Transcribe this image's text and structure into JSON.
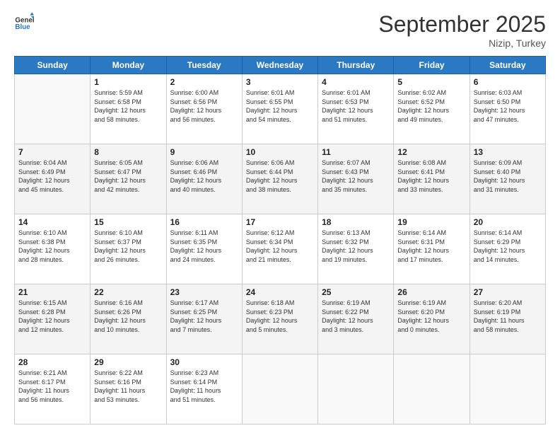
{
  "header": {
    "logo_general": "General",
    "logo_blue": "Blue",
    "month_title": "September 2025",
    "subtitle": "Nizip, Turkey"
  },
  "days_of_week": [
    "Sunday",
    "Monday",
    "Tuesday",
    "Wednesday",
    "Thursday",
    "Friday",
    "Saturday"
  ],
  "weeks": [
    [
      {
        "day": "",
        "info": ""
      },
      {
        "day": "1",
        "info": "Sunrise: 5:59 AM\nSunset: 6:58 PM\nDaylight: 12 hours\nand 58 minutes."
      },
      {
        "day": "2",
        "info": "Sunrise: 6:00 AM\nSunset: 6:56 PM\nDaylight: 12 hours\nand 56 minutes."
      },
      {
        "day": "3",
        "info": "Sunrise: 6:01 AM\nSunset: 6:55 PM\nDaylight: 12 hours\nand 54 minutes."
      },
      {
        "day": "4",
        "info": "Sunrise: 6:01 AM\nSunset: 6:53 PM\nDaylight: 12 hours\nand 51 minutes."
      },
      {
        "day": "5",
        "info": "Sunrise: 6:02 AM\nSunset: 6:52 PM\nDaylight: 12 hours\nand 49 minutes."
      },
      {
        "day": "6",
        "info": "Sunrise: 6:03 AM\nSunset: 6:50 PM\nDaylight: 12 hours\nand 47 minutes."
      }
    ],
    [
      {
        "day": "7",
        "info": "Sunrise: 6:04 AM\nSunset: 6:49 PM\nDaylight: 12 hours\nand 45 minutes."
      },
      {
        "day": "8",
        "info": "Sunrise: 6:05 AM\nSunset: 6:47 PM\nDaylight: 12 hours\nand 42 minutes."
      },
      {
        "day": "9",
        "info": "Sunrise: 6:06 AM\nSunset: 6:46 PM\nDaylight: 12 hours\nand 40 minutes."
      },
      {
        "day": "10",
        "info": "Sunrise: 6:06 AM\nSunset: 6:44 PM\nDaylight: 12 hours\nand 38 minutes."
      },
      {
        "day": "11",
        "info": "Sunrise: 6:07 AM\nSunset: 6:43 PM\nDaylight: 12 hours\nand 35 minutes."
      },
      {
        "day": "12",
        "info": "Sunrise: 6:08 AM\nSunset: 6:41 PM\nDaylight: 12 hours\nand 33 minutes."
      },
      {
        "day": "13",
        "info": "Sunrise: 6:09 AM\nSunset: 6:40 PM\nDaylight: 12 hours\nand 31 minutes."
      }
    ],
    [
      {
        "day": "14",
        "info": "Sunrise: 6:10 AM\nSunset: 6:38 PM\nDaylight: 12 hours\nand 28 minutes."
      },
      {
        "day": "15",
        "info": "Sunrise: 6:10 AM\nSunset: 6:37 PM\nDaylight: 12 hours\nand 26 minutes."
      },
      {
        "day": "16",
        "info": "Sunrise: 6:11 AM\nSunset: 6:35 PM\nDaylight: 12 hours\nand 24 minutes."
      },
      {
        "day": "17",
        "info": "Sunrise: 6:12 AM\nSunset: 6:34 PM\nDaylight: 12 hours\nand 21 minutes."
      },
      {
        "day": "18",
        "info": "Sunrise: 6:13 AM\nSunset: 6:32 PM\nDaylight: 12 hours\nand 19 minutes."
      },
      {
        "day": "19",
        "info": "Sunrise: 6:14 AM\nSunset: 6:31 PM\nDaylight: 12 hours\nand 17 minutes."
      },
      {
        "day": "20",
        "info": "Sunrise: 6:14 AM\nSunset: 6:29 PM\nDaylight: 12 hours\nand 14 minutes."
      }
    ],
    [
      {
        "day": "21",
        "info": "Sunrise: 6:15 AM\nSunset: 6:28 PM\nDaylight: 12 hours\nand 12 minutes."
      },
      {
        "day": "22",
        "info": "Sunrise: 6:16 AM\nSunset: 6:26 PM\nDaylight: 12 hours\nand 10 minutes."
      },
      {
        "day": "23",
        "info": "Sunrise: 6:17 AM\nSunset: 6:25 PM\nDaylight: 12 hours\nand 7 minutes."
      },
      {
        "day": "24",
        "info": "Sunrise: 6:18 AM\nSunset: 6:23 PM\nDaylight: 12 hours\nand 5 minutes."
      },
      {
        "day": "25",
        "info": "Sunrise: 6:19 AM\nSunset: 6:22 PM\nDaylight: 12 hours\nand 3 minutes."
      },
      {
        "day": "26",
        "info": "Sunrise: 6:19 AM\nSunset: 6:20 PM\nDaylight: 12 hours\nand 0 minutes."
      },
      {
        "day": "27",
        "info": "Sunrise: 6:20 AM\nSunset: 6:19 PM\nDaylight: 11 hours\nand 58 minutes."
      }
    ],
    [
      {
        "day": "28",
        "info": "Sunrise: 6:21 AM\nSunset: 6:17 PM\nDaylight: 11 hours\nand 56 minutes."
      },
      {
        "day": "29",
        "info": "Sunrise: 6:22 AM\nSunset: 6:16 PM\nDaylight: 11 hours\nand 53 minutes."
      },
      {
        "day": "30",
        "info": "Sunrise: 6:23 AM\nSunset: 6:14 PM\nDaylight: 11 hours\nand 51 minutes."
      },
      {
        "day": "",
        "info": ""
      },
      {
        "day": "",
        "info": ""
      },
      {
        "day": "",
        "info": ""
      },
      {
        "day": "",
        "info": ""
      }
    ]
  ]
}
